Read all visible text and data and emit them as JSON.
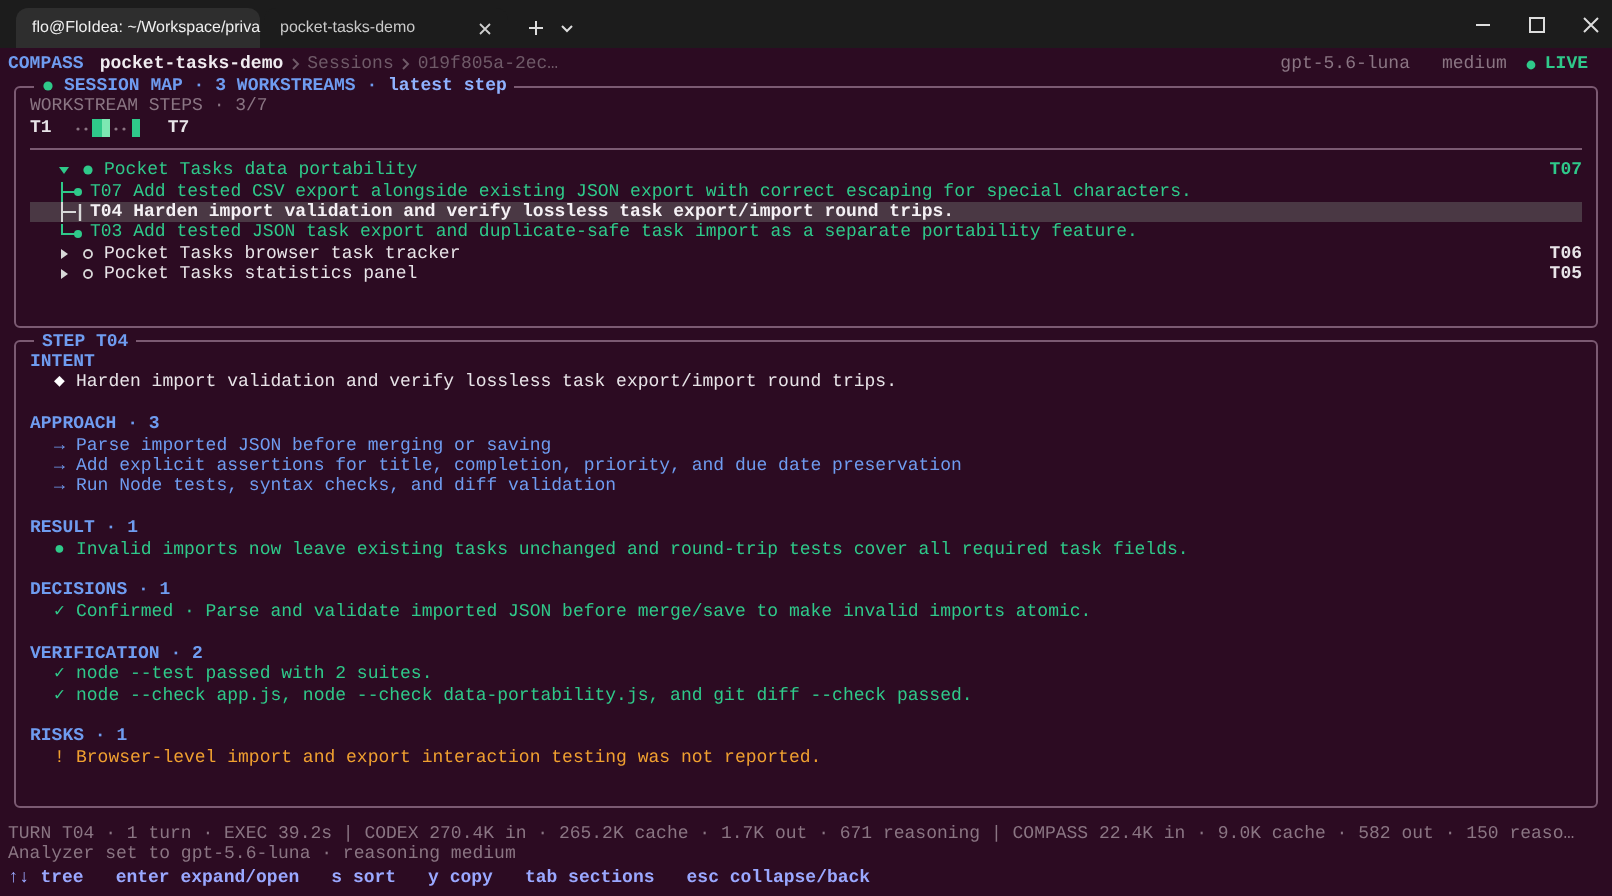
{
  "tabs": [
    {
      "label": "flo@FloIdea: ~/Workspace/priva",
      "selected": true
    },
    {
      "label": "pocket-tasks-demo",
      "selected": false
    }
  ],
  "header": {
    "app": "COMPASS",
    "project": "pocket-tasks-demo",
    "breadcrumb": [
      "Sessions",
      "019f805a-2ec…"
    ],
    "model": "gpt-5.6-luna",
    "effort": "medium",
    "status": "LIVE"
  },
  "session_map": {
    "title": "SESSION MAP · 3 WORKSTREAMS · ",
    "mode": "latest step",
    "steps_label": "WORKSTREAM STEPS · 3/7",
    "start": "T1",
    "end": "T7",
    "workstreams": [
      {
        "title": "Pocket Tasks data portability",
        "id": "T07",
        "expanded": true,
        "active": true,
        "children": [
          {
            "text": "T07 Add tested CSV export alongside existing JSON export with correct escaping for special characters.",
            "selected": false
          },
          {
            "text": "T04 Harden import validation and verify lossless task export/import round trips.",
            "selected": true
          },
          {
            "text": "T03 Add tested JSON task export and duplicate-safe task import as a separate portability feature.",
            "selected": false
          }
        ]
      },
      {
        "title": "Pocket Tasks browser task tracker",
        "id": "T06",
        "expanded": false,
        "active": false
      },
      {
        "title": "Pocket Tasks statistics panel",
        "id": "T05",
        "expanded": false,
        "active": false
      }
    ]
  },
  "step": {
    "title": "STEP T04",
    "sections": [
      {
        "heading": "INTENT",
        "kind": "intent",
        "marker": "◆",
        "items": [
          "Harden import validation and verify lossless task export/import round trips."
        ]
      },
      {
        "heading": "APPROACH · 3",
        "kind": "approach",
        "marker": "→",
        "items": [
          "Parse imported JSON before merging or saving",
          "Add explicit assertions for title, completion, priority, and due date preservation",
          "Run Node tests, syntax checks, and diff validation"
        ]
      },
      {
        "heading": "RESULT · 1",
        "kind": "result",
        "marker": "●",
        "items": [
          "Invalid imports now leave existing tasks unchanged and round-trip tests cover all required task fields."
        ]
      },
      {
        "heading": "DECISIONS · 1",
        "kind": "decision",
        "marker": "✓",
        "items": [
          "Confirmed · Parse and validate imported JSON before merge/save to make invalid imports atomic."
        ]
      },
      {
        "heading": "VERIFICATION · 2",
        "kind": "verification",
        "marker": "✓",
        "items": [
          "node --test passed with 2 suites.",
          "node --check app.js, node --check data-portability.js, and git diff --check passed."
        ]
      },
      {
        "heading": "RISKS · 1",
        "kind": "risk",
        "marker": "!",
        "items": [
          "Browser-level import and export interaction testing was not reported."
        ]
      }
    ]
  },
  "status_bar": {
    "usage": "TURN T04 · 1 turn · EXEC 39.2s | CODEX 270.4K in · 265.2K cache · 1.7K out · 671 reasoning | COMPASS 22.4K in · 9.0K cache · 582 out · 150 reaso…",
    "message": "Analyzer set to gpt-5.6-luna · reasoning medium",
    "keys": [
      {
        "key": "↑↓",
        "action": "tree"
      },
      {
        "key": "enter",
        "action": "expand/open"
      },
      {
        "key": "s",
        "action": "sort"
      },
      {
        "key": "y",
        "action": "copy"
      },
      {
        "key": "tab",
        "action": "sections"
      },
      {
        "key": "esc",
        "action": "collapse/back"
      }
    ]
  }
}
